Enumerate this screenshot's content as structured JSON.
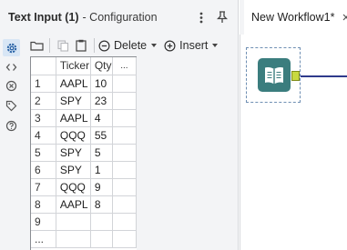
{
  "config_panel": {
    "title": "Text Input (1)",
    "subtitle": "- Configuration",
    "header_icons": [
      "kebab-menu-icon",
      "pin-icon"
    ],
    "side_rail": [
      "gear-icon",
      "code-icon",
      "x-circle-icon",
      "tag-icon",
      "help-icon"
    ]
  },
  "toolbar": {
    "delete_label": "Delete",
    "insert_label": "Insert"
  },
  "grid": {
    "columns": [
      "Ticker",
      "Qty",
      "..."
    ],
    "rows": [
      {
        "num": "1",
        "ticker": "AAPL",
        "qty": "10"
      },
      {
        "num": "2",
        "ticker": "SPY",
        "qty": "23"
      },
      {
        "num": "3",
        "ticker": "AAPL",
        "qty": "4"
      },
      {
        "num": "4",
        "ticker": "QQQ",
        "qty": "55"
      },
      {
        "num": "5",
        "ticker": "SPY",
        "qty": "5"
      },
      {
        "num": "6",
        "ticker": "SPY",
        "qty": "1"
      },
      {
        "num": "7",
        "ticker": "QQQ",
        "qty": "9"
      },
      {
        "num": "8",
        "ticker": "AAPL",
        "qty": "8"
      },
      {
        "num": "9",
        "ticker": "",
        "qty": ""
      }
    ],
    "more_rows": "..."
  },
  "workflow": {
    "tab_label": "New Workflow1*",
    "tool_name": "text-input-book-icon",
    "colors": {
      "tool_fill": "#3b7d7e",
      "anchor": "#c8d940",
      "connector": "#2f3a8c"
    }
  }
}
